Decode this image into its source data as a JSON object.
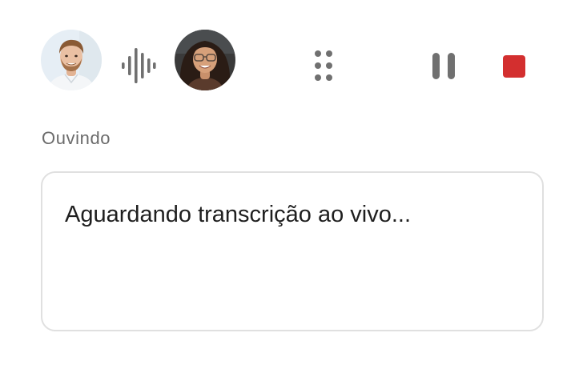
{
  "participants": [
    {
      "name": "",
      "avatar": "male-avatar",
      "background_color": "#e6eef5"
    },
    {
      "name": "",
      "avatar": "female-avatar",
      "background_color": "#3a3a3a"
    }
  ],
  "toolbar": {
    "waveform_icon": "audio-waveform-icon",
    "grip_icon": "drag-grip-icon",
    "pause_icon": "pause-icon",
    "stop_icon": "stop-icon"
  },
  "status": {
    "label": "Ouvindo"
  },
  "transcript": {
    "placeholder": "Aguardando transcrição ao vivo..."
  },
  "colors": {
    "icon_gray": "#707070",
    "stop_red": "#d32f2f",
    "status_text": "#6b6b6b",
    "border": "#e0e0e0",
    "text": "#1f1f1f"
  }
}
